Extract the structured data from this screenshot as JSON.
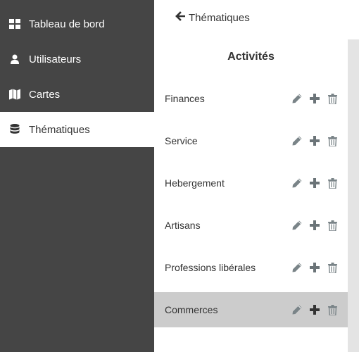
{
  "sidebar": {
    "items": [
      {
        "label": "Tableau de bord",
        "icon": "dashboard-icon"
      },
      {
        "label": "Utilisateurs",
        "icon": "user-icon"
      },
      {
        "label": "Cartes",
        "icon": "map-icon"
      },
      {
        "label": "Thématiques",
        "icon": "database-icon",
        "active": true
      }
    ]
  },
  "header": {
    "back_label": "Thématiques",
    "back_icon": "arrow-left-icon"
  },
  "panel": {
    "title": "Activités",
    "rows": [
      {
        "label": "Finances"
      },
      {
        "label": "Service"
      },
      {
        "label": "Hebergement"
      },
      {
        "label": "Artisans"
      },
      {
        "label": "Professions libérales"
      },
      {
        "label": "Commerces",
        "selected": true
      }
    ],
    "actions": [
      "pencil-icon",
      "plus-icon",
      "trash-icon"
    ]
  },
  "colors": {
    "sidebar_bg": "#454545",
    "active_bg": "#ffffff",
    "selected_row_bg": "#cccccc",
    "icon_gray": "#7a8488",
    "icon_dark": "#333333"
  }
}
